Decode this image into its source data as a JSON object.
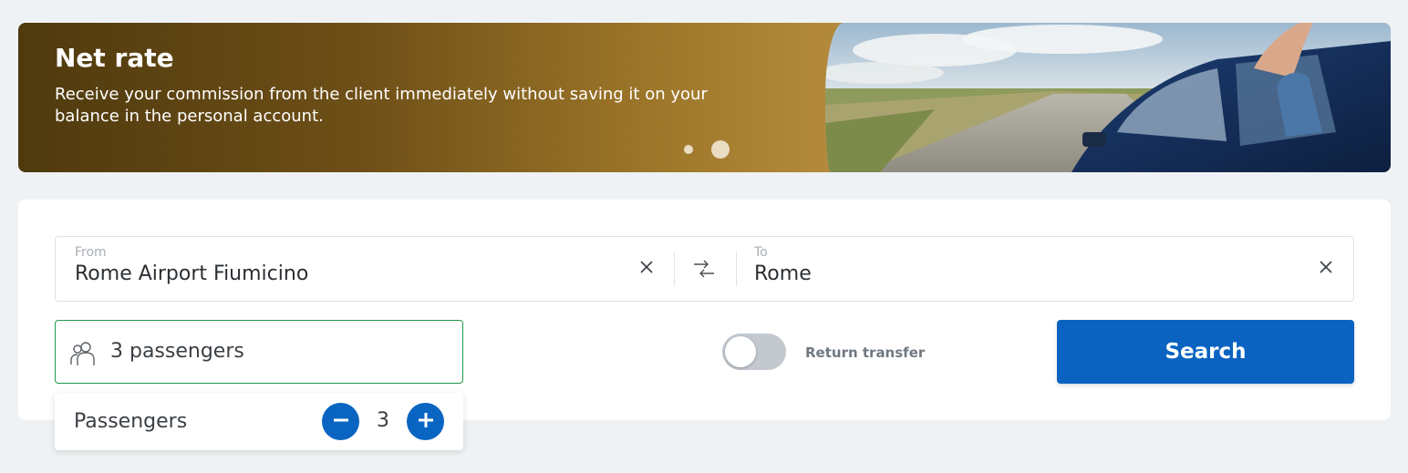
{
  "banner": {
    "title": "Net rate",
    "text": "Receive your commission from the client immediately without saving it on your balance in the personal account.",
    "slides": 2,
    "active_slide": 2
  },
  "route": {
    "from_label": "From",
    "from_value": "Rome Airport Fiumicino",
    "to_label": "To",
    "to_value": "Rome",
    "icons": {
      "clear": "close-icon",
      "swap": "swap-arrows-icon"
    }
  },
  "passengers": {
    "field_value": "3 passengers",
    "icon": "people-icon",
    "dropdown_label": "Passengers",
    "count": "3",
    "accent_color": "#0a65c2",
    "focus_border_color": "#1e9a4c"
  },
  "return_transfer": {
    "label": "Return transfer",
    "enabled": false
  },
  "search": {
    "label": "Search",
    "color": "#0a63c1"
  }
}
